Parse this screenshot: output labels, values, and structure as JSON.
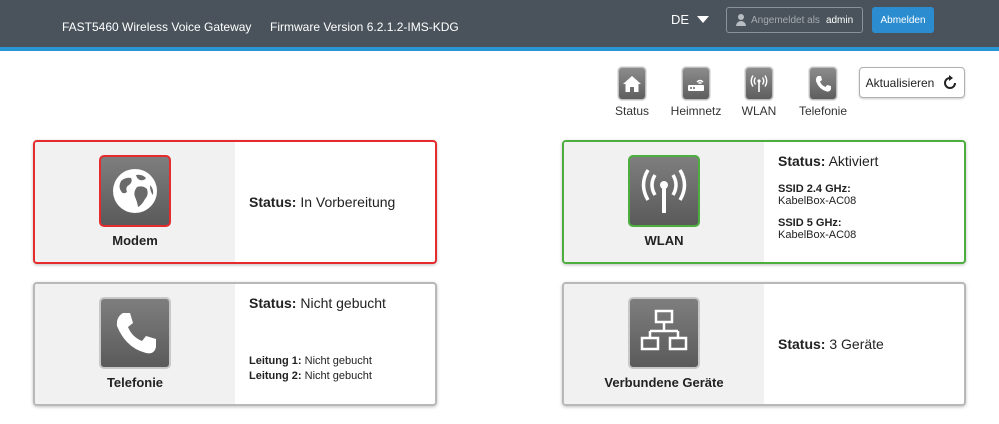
{
  "header": {
    "product": "FAST5460 Wireless Voice Gateway",
    "firmware": "Firmware Version 6.2.1.2-IMS-KDG",
    "language": "DE",
    "login_prefix": "Angemeldet als",
    "login_user": "admin",
    "logout_label": "Abmelden"
  },
  "nav": {
    "items": [
      {
        "label": "Status",
        "icon": "home-icon"
      },
      {
        "label": "Heimnetz",
        "icon": "router-icon"
      },
      {
        "label": "WLAN",
        "icon": "wifi-antenna-icon"
      },
      {
        "label": "Telefonie",
        "icon": "phone-icon"
      }
    ],
    "refresh_label": "Aktualisieren"
  },
  "cards": {
    "modem": {
      "label": "Modem",
      "icon": "globe-icon",
      "status_key": "Status:",
      "status_value": "In Vorbereitung",
      "accent": "#e52b2b"
    },
    "wlan": {
      "label": "WLAN",
      "icon": "wifi-antenna-icon",
      "status_key": "Status:",
      "status_value": "Aktiviert",
      "ssid24_key": "SSID 2.4 GHz:",
      "ssid24_value": "KabelBox-AC08",
      "ssid5_key": "SSID 5 GHz:",
      "ssid5_value": "KabelBox-AC08",
      "accent": "#4cae3e"
    },
    "telefonie": {
      "label": "Telefonie",
      "icon": "phone-icon",
      "status_key": "Status:",
      "status_value": "Nicht gebucht",
      "line1_key": "Leitung 1:",
      "line1_value": "Nicht gebucht",
      "line2_key": "Leitung 2:",
      "line2_value": "Nicht gebucht"
    },
    "devices": {
      "label": "Verbundene Geräte",
      "icon": "network-icon",
      "status_key": "Status:",
      "status_value": "3 Geräte"
    }
  },
  "colors": {
    "topbar": "#4a535b",
    "accent_blue": "#2b96d6"
  }
}
